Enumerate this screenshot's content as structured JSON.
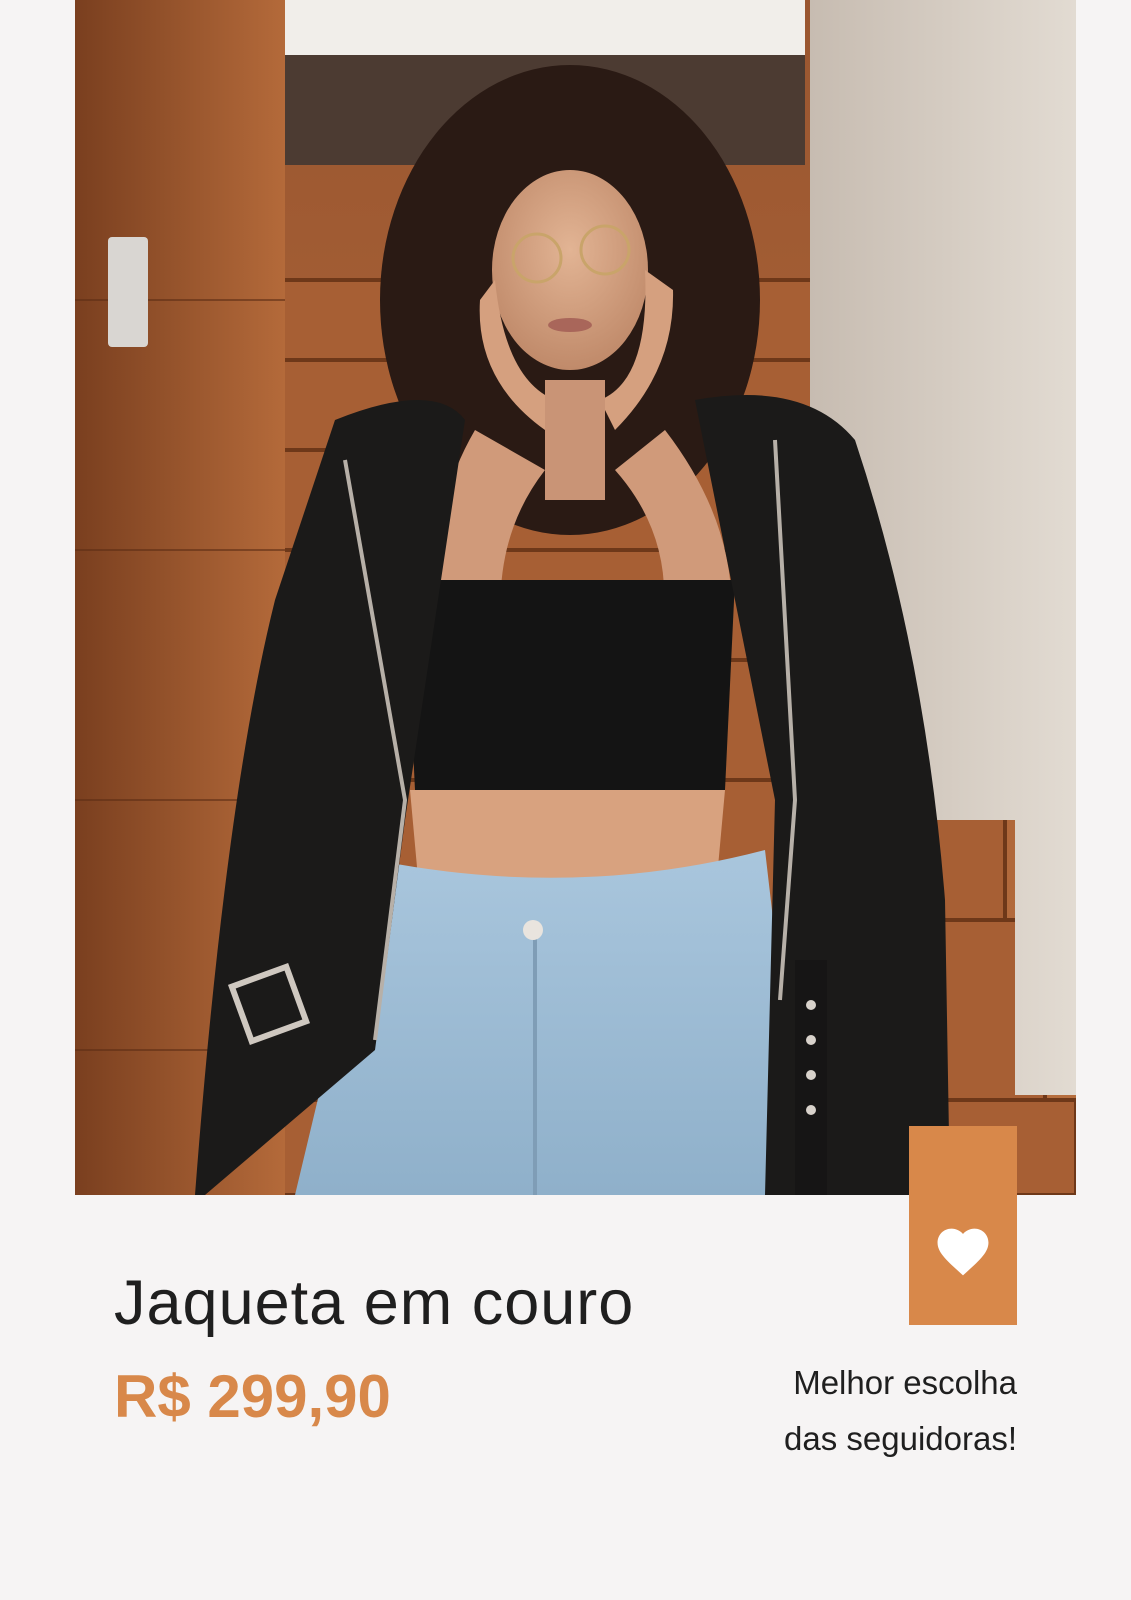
{
  "product": {
    "name": "Jaqueta em couro",
    "price": "R$ 299,90"
  },
  "tagline": {
    "line1": "Melhor escolha",
    "line2": "das seguidoras!"
  },
  "badge": {
    "icon": "heart-icon"
  },
  "colors": {
    "accent": "#d8884a",
    "background": "#f6f4f4",
    "text": "#1f1f1f"
  }
}
